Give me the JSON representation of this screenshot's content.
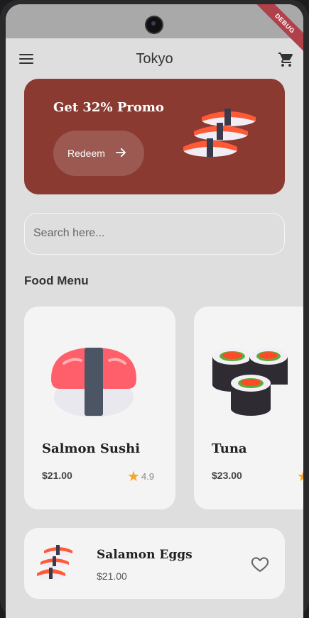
{
  "status": {
    "debug_badge": "DEBUG"
  },
  "appbar": {
    "title": "Tokyo",
    "menu_icon": "menu-icon",
    "cart_icon": "cart-icon"
  },
  "promo": {
    "title": "Get 32% Promo",
    "button_label": "Redeem",
    "button_icon": "arrow-right-icon",
    "color": "#8a3a30"
  },
  "search": {
    "placeholder": "Search here..."
  },
  "food_menu": {
    "title": "Food Menu",
    "items": [
      {
        "name": "Salmon Sushi",
        "price": "$21.00",
        "rating": "4.9"
      },
      {
        "name": "Tuna",
        "price": "$23.00"
      }
    ]
  },
  "favorite": {
    "name": "Salamon Eggs",
    "price": "$21.00",
    "icon": "heart-icon"
  }
}
